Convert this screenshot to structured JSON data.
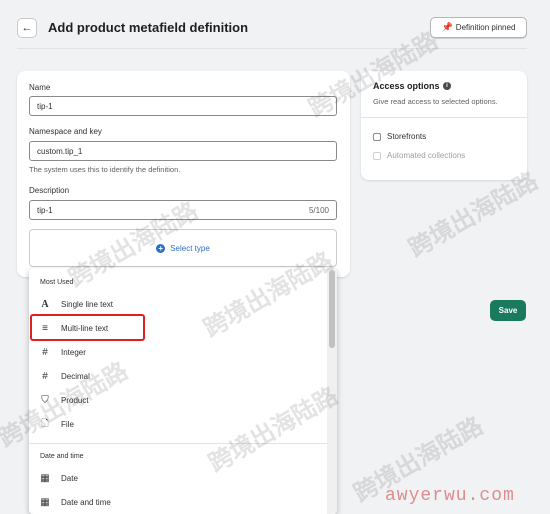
{
  "header": {
    "back_icon": "arrow-left-icon",
    "title": "Add product metafield definition",
    "pinned_label": "Definition pinned",
    "pin_icon": "pin-icon"
  },
  "form": {
    "name_label": "Name",
    "name_value": "tip-1",
    "namespace_label": "Namespace and key",
    "namespace_value": "custom.tip_1",
    "namespace_help": "The system uses this to identify the definition.",
    "description_label": "Description",
    "description_value": "tip-1",
    "description_count": "5/100",
    "select_type_label": "Select type"
  },
  "access": {
    "title": "Access options",
    "subtitle": "Give read access to selected options.",
    "options": [
      {
        "label": "Storefronts",
        "checked": false,
        "disabled": false
      },
      {
        "label": "Automated collections",
        "checked": false,
        "disabled": true
      }
    ]
  },
  "save_label": "Save",
  "dropdown": {
    "sections": [
      {
        "title": "Most Used",
        "items": [
          {
            "label": "Single line text",
            "icon": "A",
            "icon_name": "text-letter-icon"
          },
          {
            "label": "Multi-line text",
            "icon": "≡",
            "icon_name": "multiline-text-icon"
          },
          {
            "label": "Integer",
            "icon": "#",
            "icon_name": "hash-icon"
          },
          {
            "label": "Decimal",
            "icon": "#",
            "icon_name": "hash-icon"
          },
          {
            "label": "Product",
            "icon": "⛉",
            "icon_name": "product-tag-icon"
          },
          {
            "label": "File",
            "icon": "🗋",
            "icon_name": "file-icon"
          }
        ]
      },
      {
        "title": "Date and time",
        "items": [
          {
            "label": "Date",
            "icon": "▦",
            "icon_name": "calendar-icon"
          },
          {
            "label": "Date and time",
            "icon": "▦",
            "icon_name": "calendar-clock-icon"
          }
        ]
      }
    ]
  },
  "watermark": {
    "text": "跨境出海陆路",
    "site": "awyerwu.com"
  },
  "colors": {
    "primary": "#1a7a5e",
    "link": "#2c6ecb",
    "highlight": "#e02020"
  }
}
